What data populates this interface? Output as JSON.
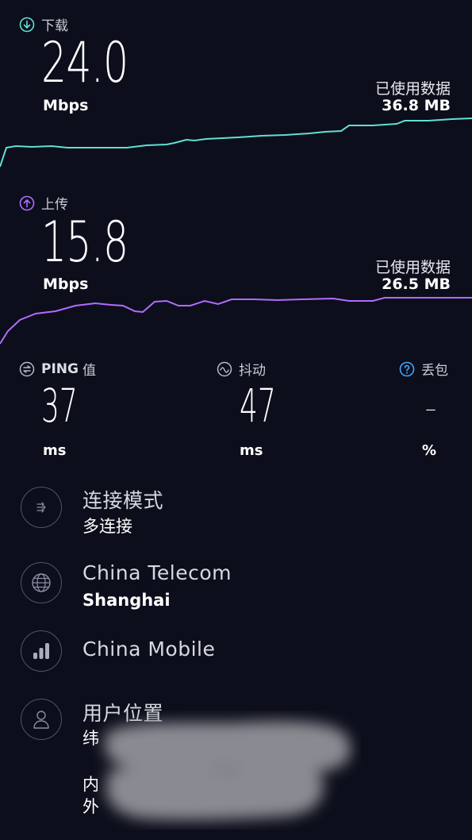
{
  "download": {
    "label": "下载",
    "value": "24.0",
    "unit": "Mbps",
    "data_used_label": "已使用数据",
    "data_used_value": "36.8 MB",
    "icon": "download-arrow-icon",
    "color": "#5fe0d4"
  },
  "upload": {
    "label": "上传",
    "value": "15.8",
    "unit": "Mbps",
    "data_used_label": "已使用数据",
    "data_used_value": "26.5 MB",
    "icon": "upload-arrow-icon",
    "color": "#b36bff"
  },
  "metrics": {
    "ping": {
      "label_en": "PING",
      "label_zh": "值",
      "value": "37",
      "unit": "ms",
      "icon": "ping-icon"
    },
    "jitter": {
      "label": "抖动",
      "value": "47",
      "unit": "ms",
      "icon": "jitter-icon"
    },
    "loss": {
      "label": "丢包",
      "value": "–",
      "unit": "%",
      "icon": "help-circle-icon",
      "accent": "#3ea7ff"
    }
  },
  "info": {
    "connection": {
      "title": "连接模式",
      "subtitle": "多连接",
      "icon": "multi-connection-icon"
    },
    "provider": {
      "title": "China Telecom",
      "subtitle": "Shanghai",
      "icon": "globe-icon"
    },
    "carrier": {
      "title": "China Mobile",
      "icon": "signal-bars-icon"
    },
    "location": {
      "title": "用户位置",
      "line1": "纬",
      "line2": "内",
      "line3": "外",
      "icon": "user-icon"
    }
  }
}
